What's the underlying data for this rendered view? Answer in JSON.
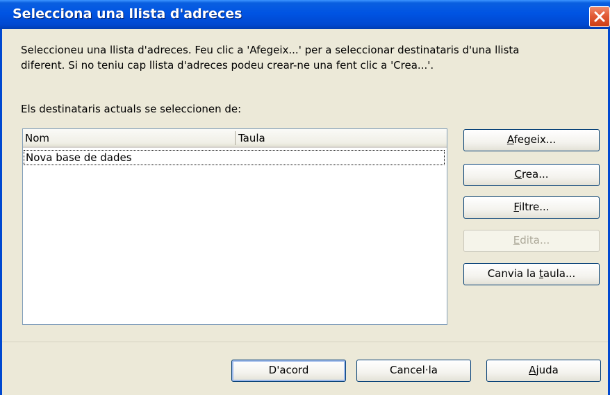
{
  "window": {
    "title": "Selecciona una llista d'adreces"
  },
  "description": {
    "line1": "Seleccioneu una llista d'adreces. Feu clic a 'Afegeix...' per a seleccionar destinataris d'una llista",
    "line2": "diferent. Si no teniu cap llista d'adreces podeu crear-ne una fent clic a 'Crea...'."
  },
  "current_label": "Els destinataris actuals se seleccionen de:",
  "list": {
    "columns": [
      "Nom",
      "Taula"
    ],
    "rows": [
      {
        "nom": "Nova base de dades",
        "taula": ""
      }
    ]
  },
  "buttons": {
    "add": {
      "label": "Afegeix...",
      "mnemonic": "A"
    },
    "create": {
      "label": "Crea...",
      "mnemonic": "C"
    },
    "filter": {
      "label": "Filtre...",
      "mnemonic": "F"
    },
    "edit": {
      "label": "Edita...",
      "mnemonic": "E",
      "enabled": false
    },
    "change_table": {
      "label": "Canvia la taula...",
      "mnemonic": "t"
    },
    "ok": {
      "label": "D'acord"
    },
    "cancel": {
      "label": "Cancel·la"
    },
    "help": {
      "label": "Ajuda",
      "mnemonic": "A"
    }
  },
  "colors": {
    "titlebar": "#0054e3",
    "dialog_bg": "#ece9d8",
    "close_button": "#e25b36",
    "button_border": "#003c74"
  }
}
